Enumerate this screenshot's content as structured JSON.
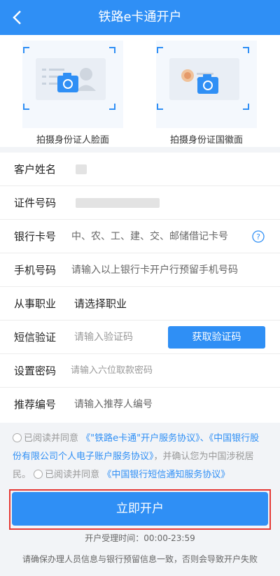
{
  "header": {
    "title": "铁路e卡通开户",
    "back_icon": "chevron-left-icon"
  },
  "photos": {
    "front_label": "拍摄身份证人脸面",
    "back_label": "拍摄身份证国徽面"
  },
  "form": {
    "name": {
      "label": "客户姓名",
      "value": ""
    },
    "id": {
      "label": "证件号码",
      "value": ""
    },
    "bank": {
      "label": "银行卡号",
      "placeholder": "中、农、工、建、交、邮储借记卡号"
    },
    "phone": {
      "label": "手机号码",
      "placeholder": "请输入以上银行卡开户行预留手机号码"
    },
    "job": {
      "label": "从事职业",
      "value": "请选择职业"
    },
    "sms": {
      "label": "短信验证",
      "placeholder": "请输入验证码",
      "button": "获取验证码"
    },
    "pwd": {
      "label": "设置密码",
      "placeholder": "请输入六位取款密码"
    },
    "ref": {
      "label": "推荐编号",
      "placeholder": "请输入推荐人编号"
    }
  },
  "agreement": {
    "prefix1": "已阅读并同意",
    "link1": "《\"铁路e卡通\"开户服务协议》、《中国银行股份有限公司个人电子账户服务协议》",
    "mid": "，并确认您为中国涉税居民。",
    "prefix2": "已阅读并同意",
    "link2": "《中国银行短信通知服务协议》"
  },
  "submit_label": "立即开户",
  "hours": "开户受理时间：00:00-23:59",
  "tip": "请确保办理人员信息与银行预留信息一致，否则会导致开户失败",
  "colors": {
    "primary": "#2f8ff5",
    "highlight": "#e53935"
  }
}
